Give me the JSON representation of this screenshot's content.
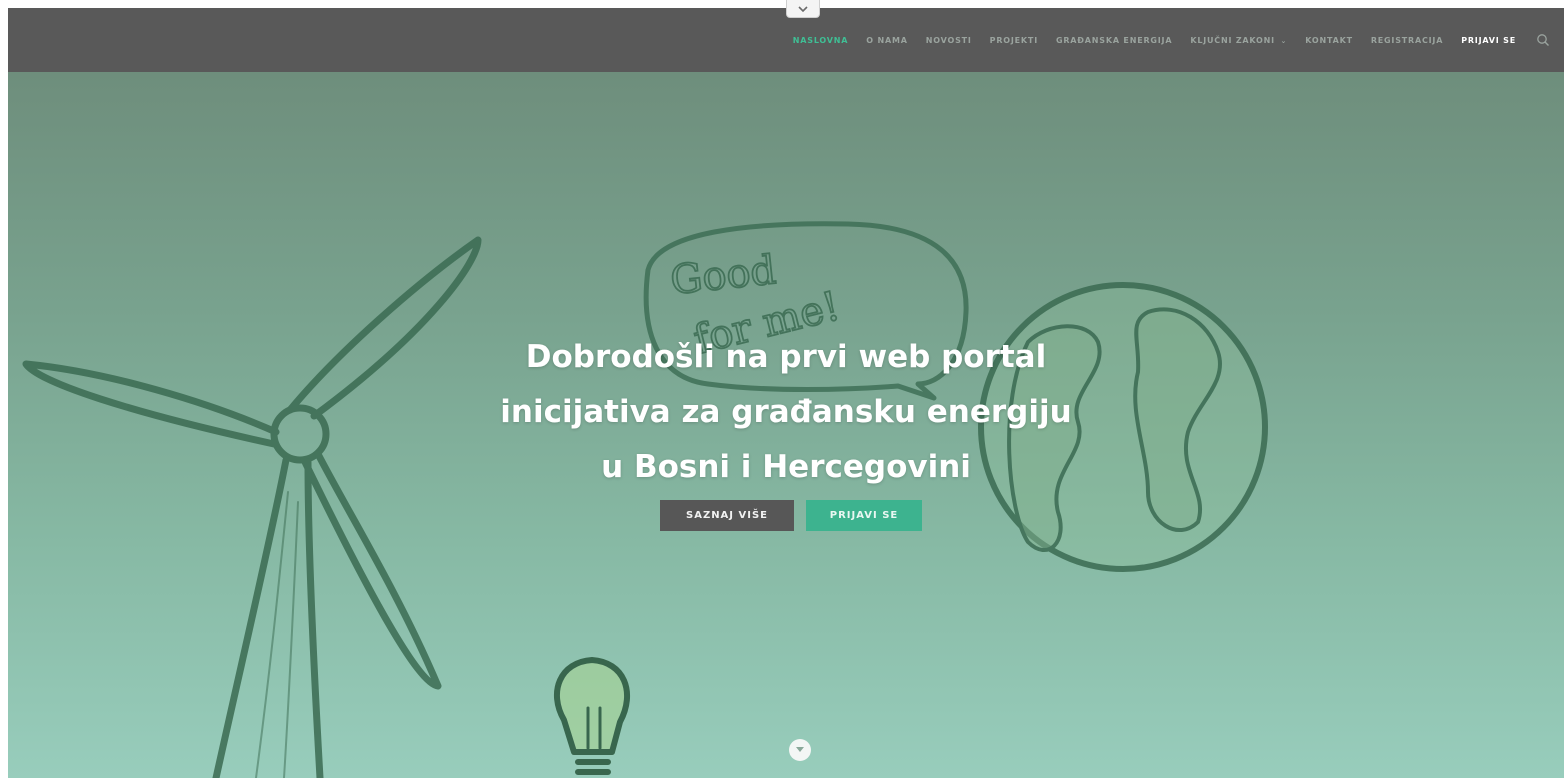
{
  "header": {
    "nav": [
      {
        "label": "Naslovna",
        "state": "active"
      },
      {
        "label": "O nama"
      },
      {
        "label": "Novosti"
      },
      {
        "label": "Projekti"
      },
      {
        "label": "Građanska energija"
      },
      {
        "label": "Ključni zakoni",
        "has_dropdown": true
      },
      {
        "label": "Kontakt"
      },
      {
        "label": "Registracija"
      },
      {
        "label": "Prijavi se",
        "state": "highlight"
      }
    ],
    "dropdown_caret": "⌄",
    "search_icon": "search-icon"
  },
  "hero": {
    "title_line1": "Dobrodošli na prvi web portal",
    "title_line2": "inicijativa za građansku energiju",
    "title_line3": "u Bosni i Hercegovini",
    "button_more": "SAZNAJ VIŠE",
    "button_login": "PRIJAVI SE",
    "illustration_text_line1": "Good",
    "illustration_text_line2": "for me!"
  },
  "colors": {
    "header_bg": "#595959",
    "nav_active": "#3fbf95",
    "nav_default": "#9aa39e",
    "hero_top": "#6e8e7c",
    "hero_bottom": "#98cdbc",
    "btn_dark": "#575757",
    "btn_green": "#3db38f"
  }
}
